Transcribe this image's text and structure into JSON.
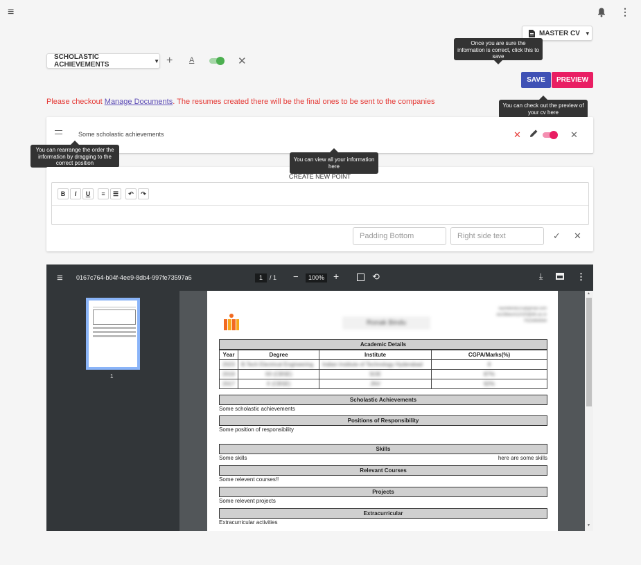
{
  "topbar": {
    "menu_icon": "menu-icon",
    "bell_icon": "bell-icon",
    "more_icon": "more-vert-icon"
  },
  "cv_selector": {
    "label": "MASTER CV",
    "icon": "document-icon"
  },
  "section_selector": {
    "label": "SCHOLASTIC ACHIEVEMENTS"
  },
  "actions": {
    "save_label": "SAVE",
    "preview_label": "PREVIEW"
  },
  "tooltips": {
    "save_hint": "Once you are sure the information is correct, click this to save",
    "preview_hint": "You can check out the preview of your cv here",
    "drag_hint": "You can rearrange the order the information by dragging to the correct position",
    "view_hint": "You can view all your information here"
  },
  "notice": {
    "prefix": "Please checkout ",
    "link": "Manage Documents",
    "suffix": ". The resumes created there will be the final ones to be sent to the companies"
  },
  "item": {
    "text": "Some scholastic achievements"
  },
  "new_point": {
    "title": "CREATE NEW POINT",
    "padding_placeholder": "Padding Bottom",
    "right_text_placeholder": "Right side text",
    "toolbar": [
      "B",
      "I",
      "U",
      "≡",
      "☰",
      "↶",
      "↷"
    ]
  },
  "pdf": {
    "filename": "0167c764-b04f-4ee9-8db4-997fe73597a6",
    "page_current": "1",
    "page_total": "/ 1",
    "zoom": "100%",
    "thumb_page_label": "1"
  },
  "resume": {
    "name": "Ronak Bindu",
    "contact": [
      "raunkbindu15@gmail.com",
      "ee19btech11020@iith.ac.in",
      "7023494944"
    ],
    "academic_title": "Academic Details",
    "academic_headers": [
      "Year",
      "Degree",
      "Institute",
      "CGPA/Marks(%)"
    ],
    "academic_rows": [
      [
        "2023",
        "B.Tech Electrical Engineering",
        "Indian Institute of Technology Hyderabad",
        "8"
      ],
      [
        "2019",
        "XII (CBSE)",
        "SOE",
        "87%"
      ],
      [
        "2017",
        "X (CBSE)",
        "JNV",
        "92%"
      ]
    ],
    "sections": [
      {
        "title": "Scholastic Achievements",
        "left": "Some scholastic achievements",
        "right": ""
      },
      {
        "title": "Positions of Responsibility",
        "left": "Some position of responsibility",
        "right": ""
      },
      {
        "title": "Skills",
        "left": "Some skills",
        "right": "here are some skills"
      },
      {
        "title": "Relevant Courses",
        "left": "Some relevent courses!!",
        "right": ""
      },
      {
        "title": "Projects",
        "left": "Some relevent projects",
        "right": ""
      },
      {
        "title": "Extracurricular",
        "left": "Extracurricular activities",
        "right": ""
      }
    ]
  },
  "colors": {
    "save": "#3f51b5",
    "preview": "#e91e63",
    "toggle_green": "#4caf50",
    "toggle_pink": "#e91e63",
    "notice": "#e53935"
  }
}
